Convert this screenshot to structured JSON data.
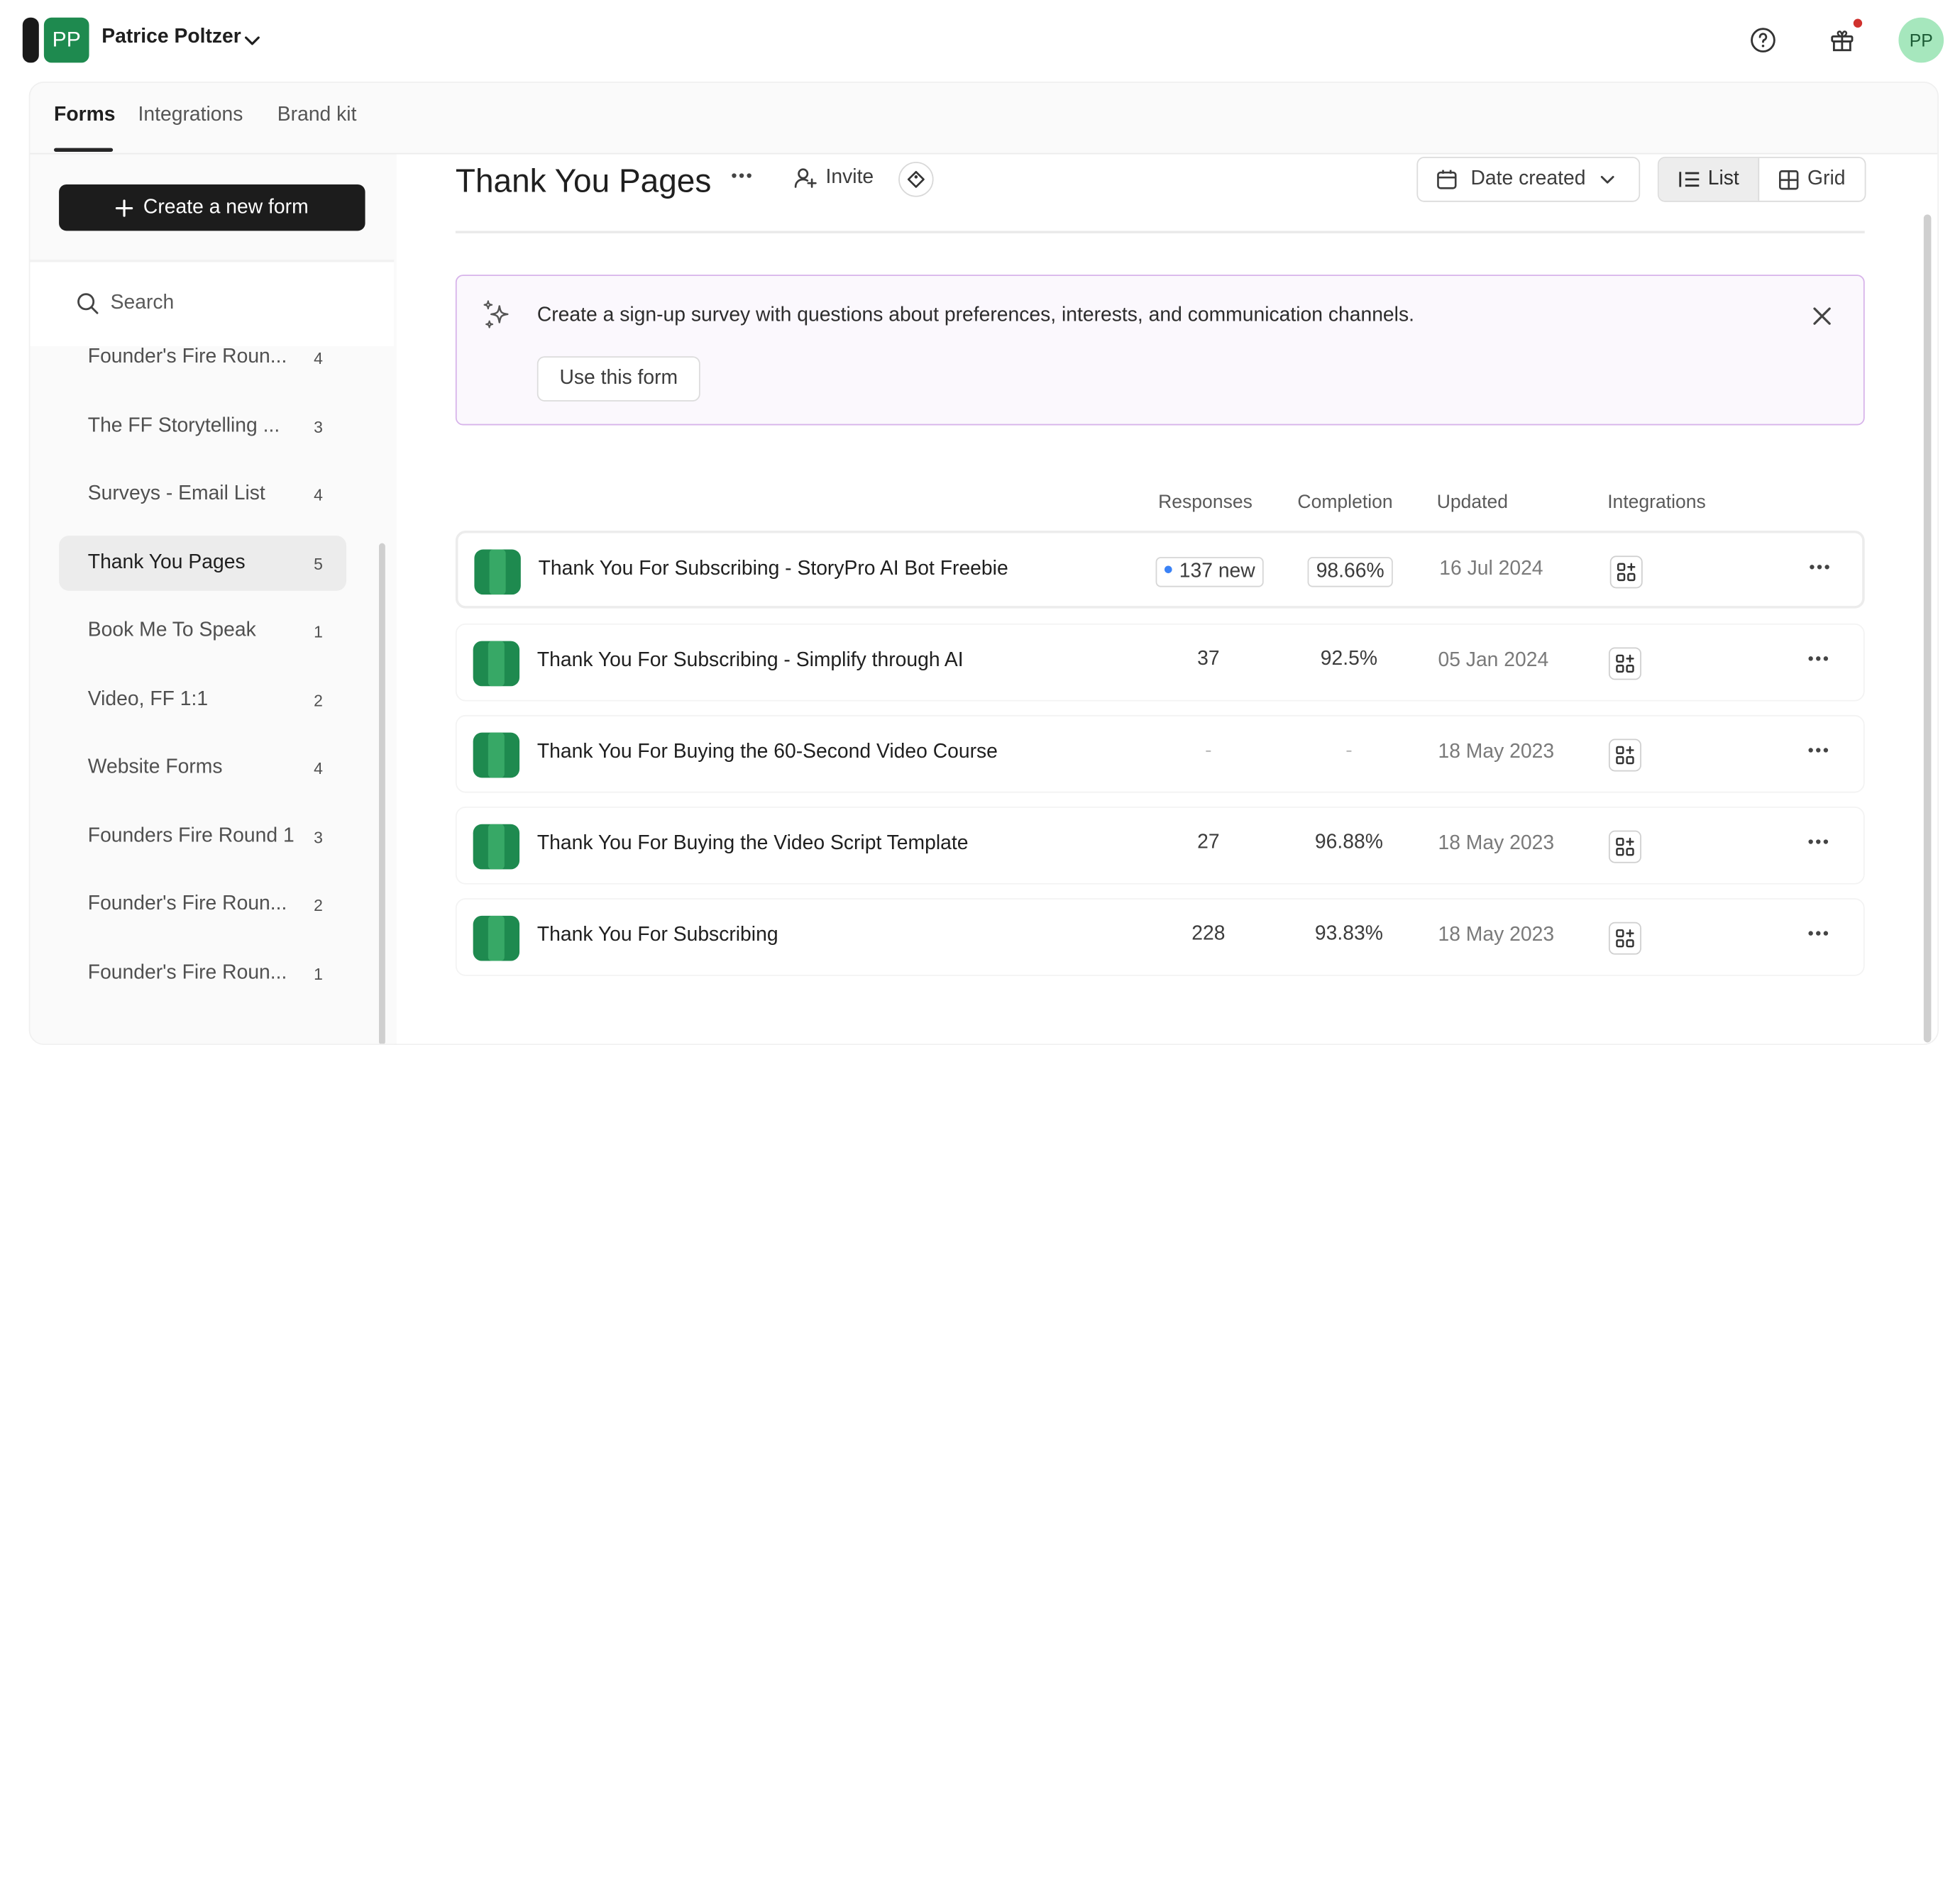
{
  "workspace": {
    "initials": "PP",
    "name": "Patrice Poltzer"
  },
  "user": {
    "initials": "PP"
  },
  "icons": {
    "help": "help-circle-icon",
    "gift": "gift-icon",
    "search": "search-icon",
    "sparkle": "sparkle-icon",
    "close": "close-icon"
  },
  "tabs": [
    {
      "label": "Forms",
      "active": true
    },
    {
      "label": "Integrations",
      "active": false
    },
    {
      "label": "Brand kit",
      "active": false
    }
  ],
  "sidebar": {
    "create_label": "Create a new form",
    "search_placeholder": "Search",
    "workspaces": [
      {
        "label": "Founder's Fire Roun...",
        "count": "4"
      },
      {
        "label": "The FF Storytelling ...",
        "count": "3"
      },
      {
        "label": "Surveys - Email List",
        "count": "4"
      },
      {
        "label": "Thank You Pages",
        "count": "5",
        "active": true
      },
      {
        "label": "Book Me To Speak",
        "count": "1"
      },
      {
        "label": "Video, FF 1:1",
        "count": "2"
      },
      {
        "label": "Website Forms",
        "count": "4"
      },
      {
        "label": "Founders Fire Round 1",
        "count": "3"
      },
      {
        "label": "Founder's Fire Roun...",
        "count": "2"
      },
      {
        "label": "Founder's Fire Roun...",
        "count": "1"
      }
    ]
  },
  "main": {
    "title": "Thank You Pages",
    "invite_label": "Invite",
    "sort_label": "Date created",
    "view_list_label": "List",
    "view_grid_label": "Grid"
  },
  "banner": {
    "text": "Create a sign-up survey with questions about preferences, interests, and communication channels.",
    "button_label": "Use this form"
  },
  "columns": {
    "responses": "Responses",
    "completion": "Completion",
    "updated": "Updated",
    "integrations": "Integrations"
  },
  "forms": [
    {
      "title": "Thank You For Subscribing - StoryPro AI Bot Freebie",
      "responses": "137 new",
      "completion": "98.66%",
      "updated": "16 Jul 2024",
      "highlight": true
    },
    {
      "title": "Thank You For Subscribing - Simplify through AI",
      "responses": "37",
      "completion": "92.5%",
      "updated": "05 Jan 2024"
    },
    {
      "title": "Thank You For Buying the 60-Second Video Course",
      "responses": "-",
      "completion": "-",
      "updated": "18 May 2023"
    },
    {
      "title": "Thank You For Buying the Video Script Template",
      "responses": "27",
      "completion": "96.88%",
      "updated": "18 May 2023"
    },
    {
      "title": "Thank You For Subscribing",
      "responses": "228",
      "completion": "93.83%",
      "updated": "18 May 2023"
    }
  ],
  "colors": {
    "accent_dark": "#1c1c1c",
    "form_green": "#1e8a4f",
    "banner_border": "#d7b3ea",
    "new_dot": "#3b82f6",
    "notif_dot": "#d0312d"
  }
}
